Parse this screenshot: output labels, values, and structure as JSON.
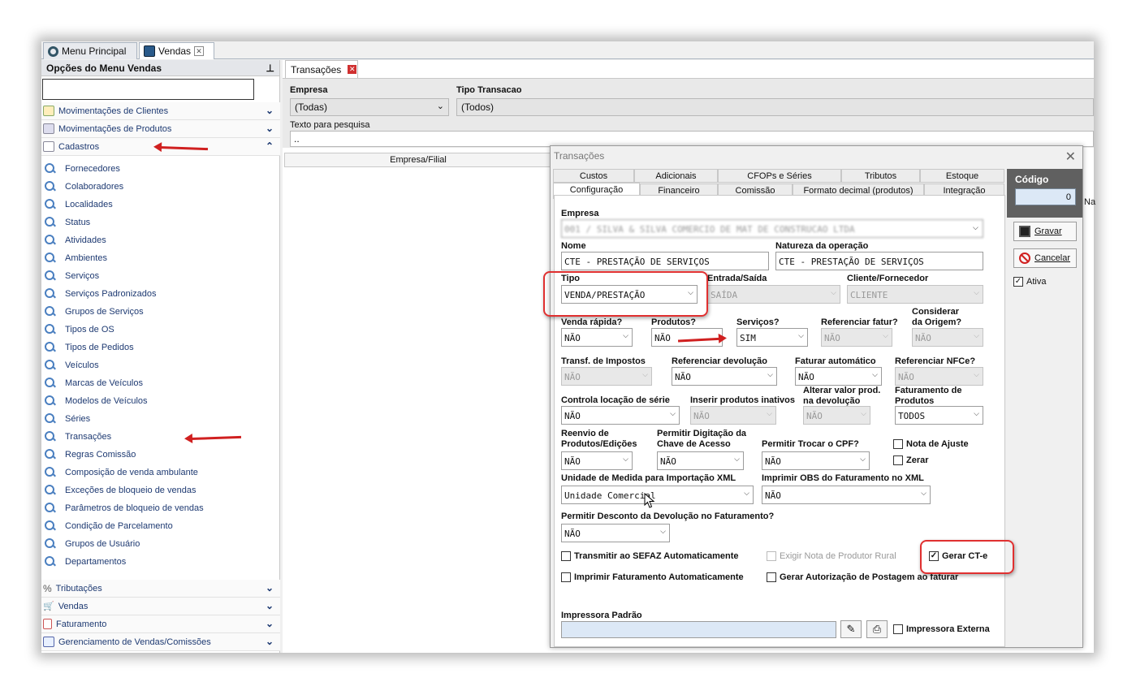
{
  "top_tabs": {
    "menu_principal": "Menu Principal",
    "vendas": "Vendas"
  },
  "sidebar": {
    "title": "Opções do Menu Vendas",
    "groups_top": [
      {
        "label": "Movimentações de Clientes"
      },
      {
        "label": "Movimentações de Produtos"
      },
      {
        "label": "Cadastros"
      }
    ],
    "items": [
      "Fornecedores",
      "Colaboradores",
      "Localidades",
      "Status",
      "Atividades",
      "Ambientes",
      "Serviços",
      "Serviços Padronizados",
      "Grupos de Serviços",
      "Tipos de OS",
      "Tipos de Pedidos",
      "Veículos",
      "Marcas de Veículos",
      "Modelos de Veículos",
      "Séries",
      "Transações",
      "Regras Comissão",
      "Composição de venda ambulante",
      "Exceções de bloqueio de vendas",
      "Parâmetros de bloqueio de vendas",
      "Condição de Parcelamento",
      "Grupos de Usuário",
      "Departamentos"
    ],
    "groups_bottom": [
      {
        "label": "Tributações"
      },
      {
        "label": "Vendas"
      },
      {
        "label": "Faturamento"
      },
      {
        "label": "Gerenciamento de Vendas/Comissões"
      }
    ]
  },
  "main": {
    "tab_label": "Transações",
    "empresa_label": "Empresa",
    "empresa_value": "(Todas)",
    "tipo_label": "Tipo Transacao",
    "tipo_value": "(Todos)",
    "texto_label": "Texto para pesquisa",
    "texto_value": "..",
    "grid_header": "Empresa/Filial",
    "grid_header_right": "Na"
  },
  "dialog": {
    "title": "Transações",
    "tabs_row1": [
      "Custos",
      "Adicionais",
      "CFOPs e Séries",
      "Tributos",
      "Estoque"
    ],
    "tabs_row2": [
      "Configuração",
      "Financeiro",
      "Comissão",
      "Formato decimal (produtos)",
      "Integração"
    ],
    "empresa_label": "Empresa",
    "empresa_value": "001 / SILVA & SILVA COMERCIO DE MAT DE CONSTRUCAO LTDA",
    "nome_label": "Nome",
    "nome_value": "CTE - PRESTAÇÃO DE SERVIÇOS",
    "natureza_label": "Natureza da operação",
    "natureza_value": "CTE - PRESTAÇÃO DE SERVIÇOS",
    "tipo_label": "Tipo",
    "tipo_value": "VENDA/PRESTAÇÃO",
    "entrada_label": "Entrada/Saída",
    "entrada_value": "SAÍDA",
    "cliente_label": "Cliente/Fornecedor",
    "cliente_value": "CLIENTE",
    "venda_rapida_label": "Venda rápida?",
    "venda_rapida_value": "NÃO",
    "produtos_label": "Produtos?",
    "produtos_value": "NÃO",
    "servicos_label": "Serviços?",
    "servicos_value": "SIM",
    "ref_fatur_label": "Referenciar fatur?",
    "ref_fatur_value": "NÃO",
    "considerar_label_1": "Considerar",
    "considerar_label_2": "da Origem?",
    "considerar_value": "NÃO",
    "transf_label": "Transf. de Impostos",
    "transf_value": "NÃO",
    "ref_devol_label": "Referenciar devolução",
    "ref_devol_value": "NÃO",
    "faturar_label": "Faturar automático",
    "faturar_value": "NÃO",
    "ref_nfce_label": "Referenciar NFCe?",
    "ref_nfce_value": "NÃO",
    "controla_label": "Controla locação de série",
    "controla_value": "NÃO",
    "inserir_label": "Inserir produtos inativos",
    "inserir_value": "NÃO",
    "alterar_label_1": "Alterar valor prod.",
    "alterar_label_2": "na devolução",
    "alterar_value": "NÃO",
    "fat_prod_label_1": "Faturamento de",
    "fat_prod_label_2": "Produtos",
    "fat_prod_value": "TODOS",
    "reenvio_label_1": "Reenvio de",
    "reenvio_label_2": "Produtos/Edições",
    "reenvio_value": "NÃO",
    "permitir_dig_label_1": "Permitir Digitação da",
    "permitir_dig_label_2": "Chave de Acesso",
    "permitir_dig_value": "NÃO",
    "permitir_cpf_label": "Permitir Trocar o CPF?",
    "permitir_cpf_value": "NÃO",
    "nota_ajuste_label": "Nota de Ajuste",
    "zerar_label": "Zerar",
    "unidade_label": "Unidade de Medida para Importação XML",
    "unidade_value": "Unidade Comercial",
    "imprimir_obs_label": "Imprimir OBS do Faturamento no XML",
    "imprimir_obs_value": "NÃO",
    "desconto_label": "Permitir Desconto da Devolução no Faturamento?",
    "desconto_value": "NÃO",
    "transmitir_label": "Transmitir ao SEFAZ Automaticamente",
    "exigir_label": "Exigir Nota de Produtor Rural",
    "gerar_cte_label": "Gerar CT-e",
    "imprimir_fat_label": "Imprimir Faturamento Automaticamente",
    "gerar_aut_label": "Gerar Autorização de Postagem ao faturar",
    "impressora_label": "Impressora Padrão",
    "impressora_externa_label": "Impressora Externa",
    "codigo_label": "Código",
    "codigo_value": "0",
    "gravar_label": "Gravar",
    "cancelar_label": "Cancelar",
    "ativa_label": "Ativa"
  },
  "colors": {
    "highlight": "#e03030",
    "link": "#1e3a72",
    "codigo_panel": "#606060"
  }
}
